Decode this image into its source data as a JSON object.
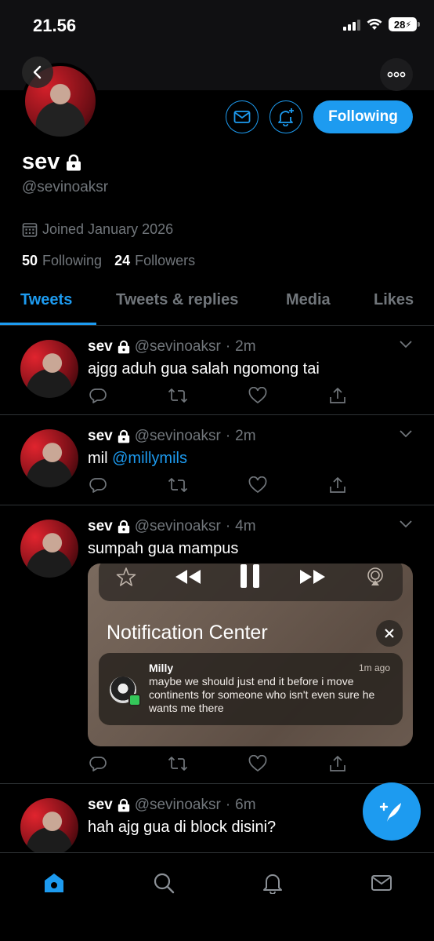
{
  "status_bar": {
    "time": "21.56",
    "battery": "28"
  },
  "profile": {
    "display_name": "sev",
    "handle": "@sevinoaksr",
    "joined": "Joined January 2026",
    "following_count": "50",
    "following_label": "Following",
    "followers_count": "24",
    "followers_label": "Followers",
    "follow_button": "Following"
  },
  "tabs": [
    {
      "label": "Tweets"
    },
    {
      "label": "Tweets & replies"
    },
    {
      "label": "Media"
    },
    {
      "label": "Likes"
    }
  ],
  "tweets": [
    {
      "name": "sev",
      "handle": "@sevinoaksr",
      "time": "2m",
      "text": "ajgg aduh gua salah ngomong tai"
    },
    {
      "name": "sev",
      "handle": "@sevinoaksr",
      "time": "2m",
      "text_prefix": "mil",
      "mention": "@millymils"
    },
    {
      "name": "sev",
      "handle": "@sevinoaksr",
      "time": "4m",
      "text": "sumpah gua mampus",
      "media": {
        "title": "Notification Center",
        "notification": {
          "sender": "Milly",
          "time": "1m ago",
          "body": "maybe we should just end it before i move continents for someone who isn't even sure he wants me there"
        }
      }
    },
    {
      "name": "sev",
      "handle": "@sevinoaksr",
      "time": "6m",
      "text": "hah ajg gua di block disini?"
    }
  ],
  "colors": {
    "accent": "#1d9bf0",
    "background": "#000000",
    "muted": "#71767b"
  }
}
